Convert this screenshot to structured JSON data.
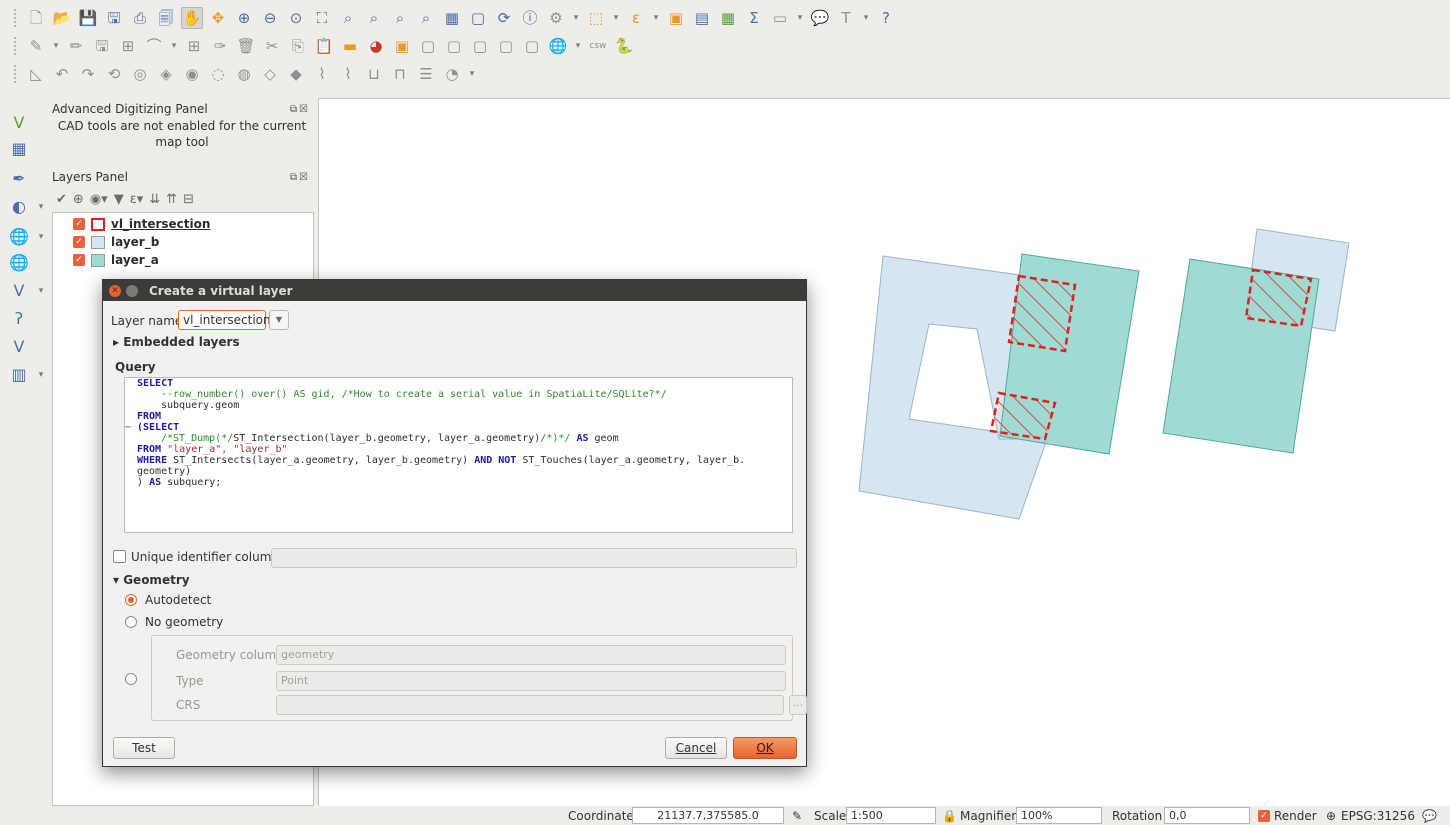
{
  "toolbar": {
    "row1_icons": [
      "new-file-icon",
      "open-folder-icon",
      "save-icon",
      "save-as-icon",
      "new-print-layout-icon",
      "layout-manager-icon",
      "pan-icon",
      "pan-to-selection-icon",
      "zoom-in-icon",
      "zoom-out-icon",
      "zoom-native-icon",
      "zoom-full-icon",
      "zoom-to-selection-icon",
      "zoom-to-layer-icon",
      "zoom-last-icon",
      "zoom-next-icon",
      "new-map-view-icon",
      "new-bookmark-icon",
      "refresh-icon",
      "identify-icon",
      "run-feature-action-icon",
      "select-features-icon",
      "select-by-value-icon",
      "deselect-icon",
      "attribute-table-icon",
      "field-calculator-icon",
      "statistics-icon",
      "measure-icon",
      "map-tips-icon",
      "text-annotation-icon",
      "help-icon"
    ],
    "row2_icons": [
      "current-edits-icon",
      "toggle-editing-icon",
      "save-edits-icon",
      "add-feature-icon",
      "digitize-icon",
      "move-feature-icon",
      "node-tool-icon",
      "delete-selected-icon",
      "cut-features-icon",
      "copy-features-icon",
      "paste-features-icon",
      "label-icon",
      "diagram-icon",
      "layer-labeling-icon",
      "pin-labels-icon",
      "show-hide-labels-icon",
      "move-label-icon",
      "rotate-label-icon",
      "change-label-icon",
      "metasearch-icon",
      "csw-icon",
      "python-console-icon"
    ],
    "row3_icons": [
      "enable-snapping-icon",
      "undo-icon",
      "redo-icon",
      "simplify-icon",
      "add-ring-icon",
      "add-part-icon",
      "fill-ring-icon",
      "delete-ring-icon",
      "delete-part-icon",
      "reshape-icon",
      "offset-curve-icon",
      "split-features-icon",
      "split-parts-icon",
      "merge-features-icon",
      "merge-attributes-icon",
      "rotate-point-symbols-icon",
      "offset-point-symbols-icon"
    ]
  },
  "left_toolbar": [
    "add-vector-layer-icon",
    "add-raster-layer-icon",
    "add-delimited-text-icon",
    "add-spatialite-icon",
    "add-wms-icon",
    "add-wcs-icon",
    "add-wfs-icon",
    "add-virtual-layer-icon",
    "add-postgis-icon",
    "add-mssql-icon"
  ],
  "advanced_panel": {
    "title": "Advanced Digitizing Panel",
    "message": "CAD tools are not enabled for the current map tool"
  },
  "layers_panel": {
    "title": "Layers Panel",
    "layers": [
      {
        "name": "vl_intersection",
        "swatch": "#ffffff",
        "swatch_border": "#e02020"
      },
      {
        "name": "layer_b",
        "swatch": "#d5e6f1",
        "swatch_border": "#9fb3c4"
      },
      {
        "name": "layer_a",
        "swatch": "#9fdbd2",
        "swatch_border": "#52a897"
      }
    ]
  },
  "dialog": {
    "title": "Create a virtual layer",
    "layer_name_label": "Layer name",
    "layer_name_value": "vl_intersection",
    "embedded_layers_label": "Embedded layers",
    "query_label": "Query",
    "unique_id_label": "Unique identifier column",
    "geometry_label": "Geometry",
    "autodetect_label": "Autodetect",
    "no_geometry_label": "No geometry",
    "geometry_column_label": "Geometry column",
    "geometry_column_value": "geometry",
    "type_label": "Type",
    "type_value": "Point",
    "crs_label": "CRS",
    "crs_button": "...",
    "test_button": "Test",
    "cancel_button": "Cancel",
    "ok_button": "OK"
  },
  "query": {
    "l1": "SELECT",
    "l2": "--row_number() over() AS gid, /*How to create a serial value in SpatiaLite/SQLite?*/",
    "l3": "subquery.geom",
    "l4": "FROM",
    "l5_kw": "(SELECT",
    "l6_cm": "/*ST_Dump(*/",
    "l6_fn": "ST_Intersection(layer_b.geometry, layer_a.geometry)",
    "l6_cm2": "/*)*/",
    "l6_as": "AS",
    "l6_end": "geom",
    "l7_kw": "FROM",
    "l7_st": "\"layer_a\", \"layer_b\"",
    "l8_kw": "WHERE",
    "l8_a": "ST_Intersects(layer_a.geometry, layer_b.geometry)",
    "l8_and": "AND NOT",
    "l8_b": "ST_Touches(layer_a.geometry, layer_b.",
    "l9": "geometry)",
    "l10_a": ")",
    "l10_as": "AS",
    "l10_b": "subquery;"
  },
  "statusbar": {
    "coordinate_label": "Coordinate",
    "coordinate_value": "21137.7,375585.0",
    "scale_label": "Scale",
    "scale_value": "1:500",
    "magnifier_label": "Magnifier",
    "magnifier_value": "100%",
    "rotation_label": "Rotation",
    "rotation_value": "0,0",
    "render_label": "Render",
    "crs_value": "EPSG:31256"
  },
  "colors": {
    "layer_b_fill": "#d5e6f1",
    "layer_a_fill": "#9fdbd2",
    "intersection_stroke": "#e02020",
    "accent": "#e9622c"
  }
}
